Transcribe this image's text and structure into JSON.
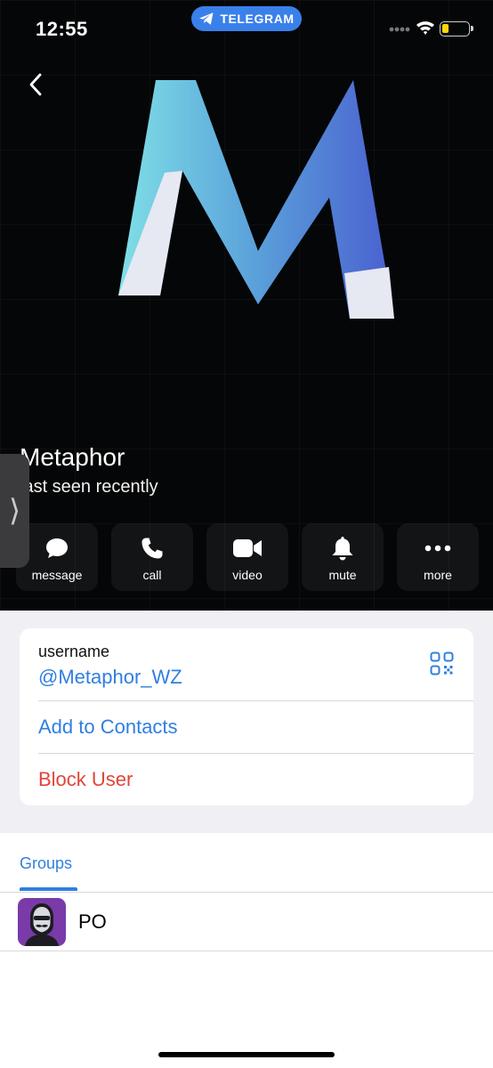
{
  "status_bar": {
    "time": "12:55",
    "app_pill": "TELEGRAM"
  },
  "profile": {
    "name": "Metaphor",
    "last_seen": "last seen recently"
  },
  "actions": [
    {
      "label": "message",
      "icon": "message-icon"
    },
    {
      "label": "call",
      "icon": "phone-icon"
    },
    {
      "label": "video",
      "icon": "video-camera-icon"
    },
    {
      "label": "mute",
      "icon": "bell-icon"
    },
    {
      "label": "more",
      "icon": "more-dots-icon"
    }
  ],
  "info": {
    "username_label": "username",
    "username_value": "@Metaphor_WZ",
    "add_contacts": "Add to Contacts",
    "block_user": "Block User"
  },
  "tabs": {
    "groups": "Groups"
  },
  "groups": [
    {
      "name": "PO"
    }
  ],
  "colors": {
    "accent": "#2f7fe0",
    "danger": "#e0453a",
    "pill": "#3a80ea",
    "group_avatar": "#7a3aa8"
  }
}
